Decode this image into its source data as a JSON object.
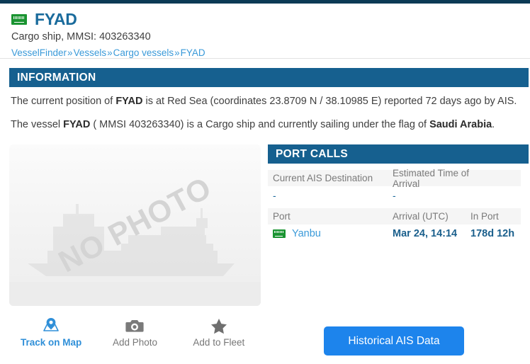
{
  "header": {
    "flag_icon": "saudi-arabia-flag-icon",
    "vessel_name": "FYAD",
    "subtitle": "Cargo ship, MMSI: 403263340",
    "breadcrumb": {
      "items": [
        "VesselFinder",
        "Vessels",
        "Cargo vessels",
        "FYAD"
      ],
      "separator": "»"
    }
  },
  "information": {
    "section_title": "INFORMATION",
    "paragraph1": {
      "part1": "The current position of ",
      "vessel": "FYAD",
      "part2": " is at Red Sea (coordinates 23.8709 N / 38.10985 E) reported 72 days ago by AIS."
    },
    "paragraph2": {
      "part1": "The vessel ",
      "vessel": "FYAD",
      "part2": " ( MMSI 403263340) is a Cargo ship and currently sailing under the flag of ",
      "flag_country": "Saudi Arabia",
      "part3": "."
    }
  },
  "photo": {
    "watermark": "NO PHOTO",
    "ship_icon": "cargo-ship-silhouette-icon"
  },
  "port_calls": {
    "section_title": "PORT CALLS",
    "destination_headers": [
      "Current AIS Destination",
      "Estimated Time of Arrival"
    ],
    "destination_values": [
      "-",
      "-"
    ],
    "port_headers": [
      "Port",
      "Arrival (UTC)",
      "In Port"
    ],
    "rows": [
      {
        "flag_icon": "saudi-arabia-flag-icon",
        "port": "Yanbu",
        "arrival": "Mar 24, 14:14",
        "in_port": "178d 12h"
      }
    ]
  },
  "actions": [
    {
      "label": "Track on Map",
      "icon": "map-pin-icon"
    },
    {
      "label": "Add Photo",
      "icon": "camera-icon"
    },
    {
      "label": "Add to Fleet",
      "icon": "star-icon"
    }
  ],
  "ais_button": {
    "label": "Historical AIS Data"
  },
  "colors": {
    "top_strip": "#0b3a55",
    "section_bar": "#16608f",
    "link": "#3a9ad9",
    "accent_button": "#1d84ec",
    "flag_green": "#1a9431"
  }
}
